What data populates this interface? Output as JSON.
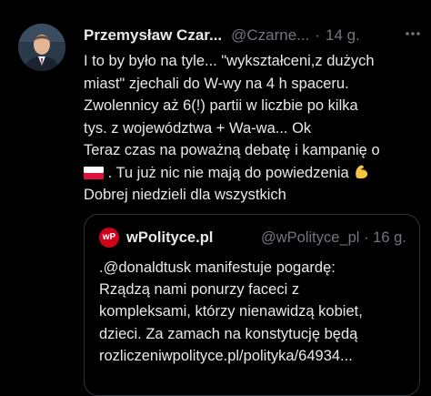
{
  "author": {
    "name": "Przemysław Czar...",
    "handle": "@Czarne...",
    "separator": "·",
    "time": "14 g."
  },
  "more_icon": "more-horizontal-icon",
  "tweet": {
    "line1": "I to by było na tyle... \"wykształceni,z dużych",
    "line2": "miast\" zjechali do W-wy na 4 h spaceru.",
    "line3": "Zwolennicy aż 6(!) partii w liczbie po kilka",
    "line4": "tys. z województwa + Wa-wa... Ok",
    "line5": "Teraz czas na poważną debatę i kampanię o",
    "line6": " . Tu już nic nie mają do powiedzenia ",
    "line7": "Dobrej niedzieli dla wszystkich"
  },
  "emoji": {
    "flag": "polish-flag-emoji",
    "biceps": "flexed-biceps-emoji"
  },
  "quote": {
    "logo_text": "wP",
    "name": "wPolityce.pl",
    "handle": "@wPolityce_pl",
    "separator": "·",
    "time": "16 g.",
    "line1": ".@donaldtusk manifestuje pogardę:",
    "line2": "Rządzą nami ponurzy faceci z",
    "line3": "kompleksami, którzy nienawidzą kobiet,",
    "line4": "dzieci. Za zamach na konstytucję będą",
    "line5": "rozliczeniwpolityce.pl/polityka/64934..."
  },
  "colors": {
    "background": "#000000",
    "text": "#e7e9ea",
    "secondary": "#71767b",
    "border": "#2f3336",
    "wp_brand": "#d0021b"
  }
}
